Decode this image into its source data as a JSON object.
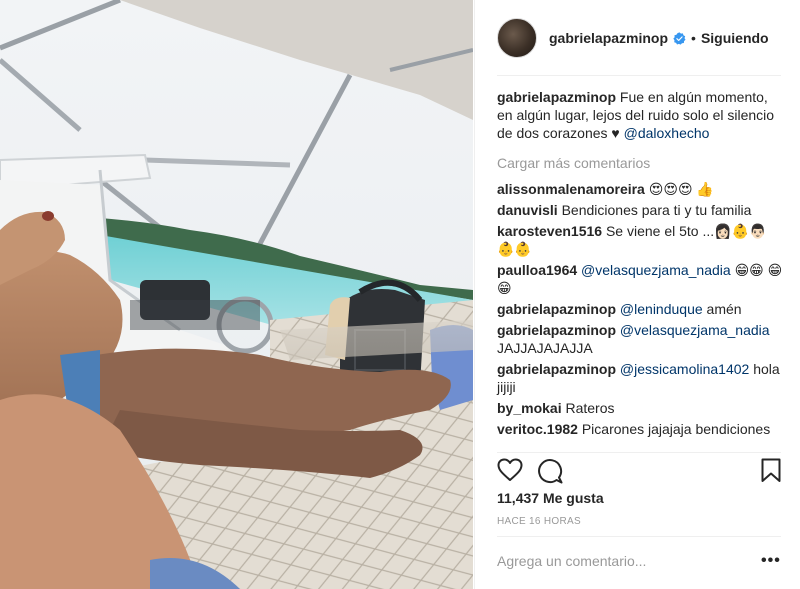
{
  "post": {
    "username": "gabrielapazminop",
    "follow_status": "Siguiendo",
    "dot": "•",
    "caption": {
      "username": "gabrielapazminop",
      "text": "Fue en algún momento, en algún lugar, lejos del ruido solo el silencio de dos corazones ♥",
      "mention": "@daloxhecho"
    },
    "load_more": "Cargar más comentarios",
    "comments": [
      {
        "username": "alissonmalenamoreira",
        "text": "😍😍😍 👍"
      },
      {
        "username": "danuvisli",
        "text": "Bendiciones para ti y tu familia"
      },
      {
        "username": "karosteven1516",
        "text": "Se viene el 5to ...👩🏻👶👨🏻 👶👶"
      },
      {
        "username": "paulloa1964",
        "mention": "@velasquezjama_nadia",
        "text": "😁😁 😁😁"
      },
      {
        "username": "gabrielapazminop",
        "mention": "@leninduque",
        "text": "amén"
      },
      {
        "username": "gabrielapazminop",
        "mention": "@velasquezjama_nadia",
        "text": "JAJJAJAJAJJA"
      },
      {
        "username": "gabrielapazminop",
        "mention": "@jessicamolina1402",
        "text": "hola jijiji"
      },
      {
        "username": "by_mokai",
        "text": "Rateros"
      },
      {
        "username": "veritoc.1982",
        "text": "Picarones jajajaja bendiciones"
      }
    ],
    "likes": "11,437 Me gusta",
    "time": "HACE 16 HORAS",
    "add_comment_placeholder": "Agrega un comentario...",
    "options": "•••"
  },
  "colors": {
    "verified": "#3897f0",
    "mention": "#003569",
    "muted": "#999999"
  },
  "icons": [
    "heart-icon",
    "comment-icon",
    "bookmark-icon",
    "verified-badge-icon"
  ]
}
